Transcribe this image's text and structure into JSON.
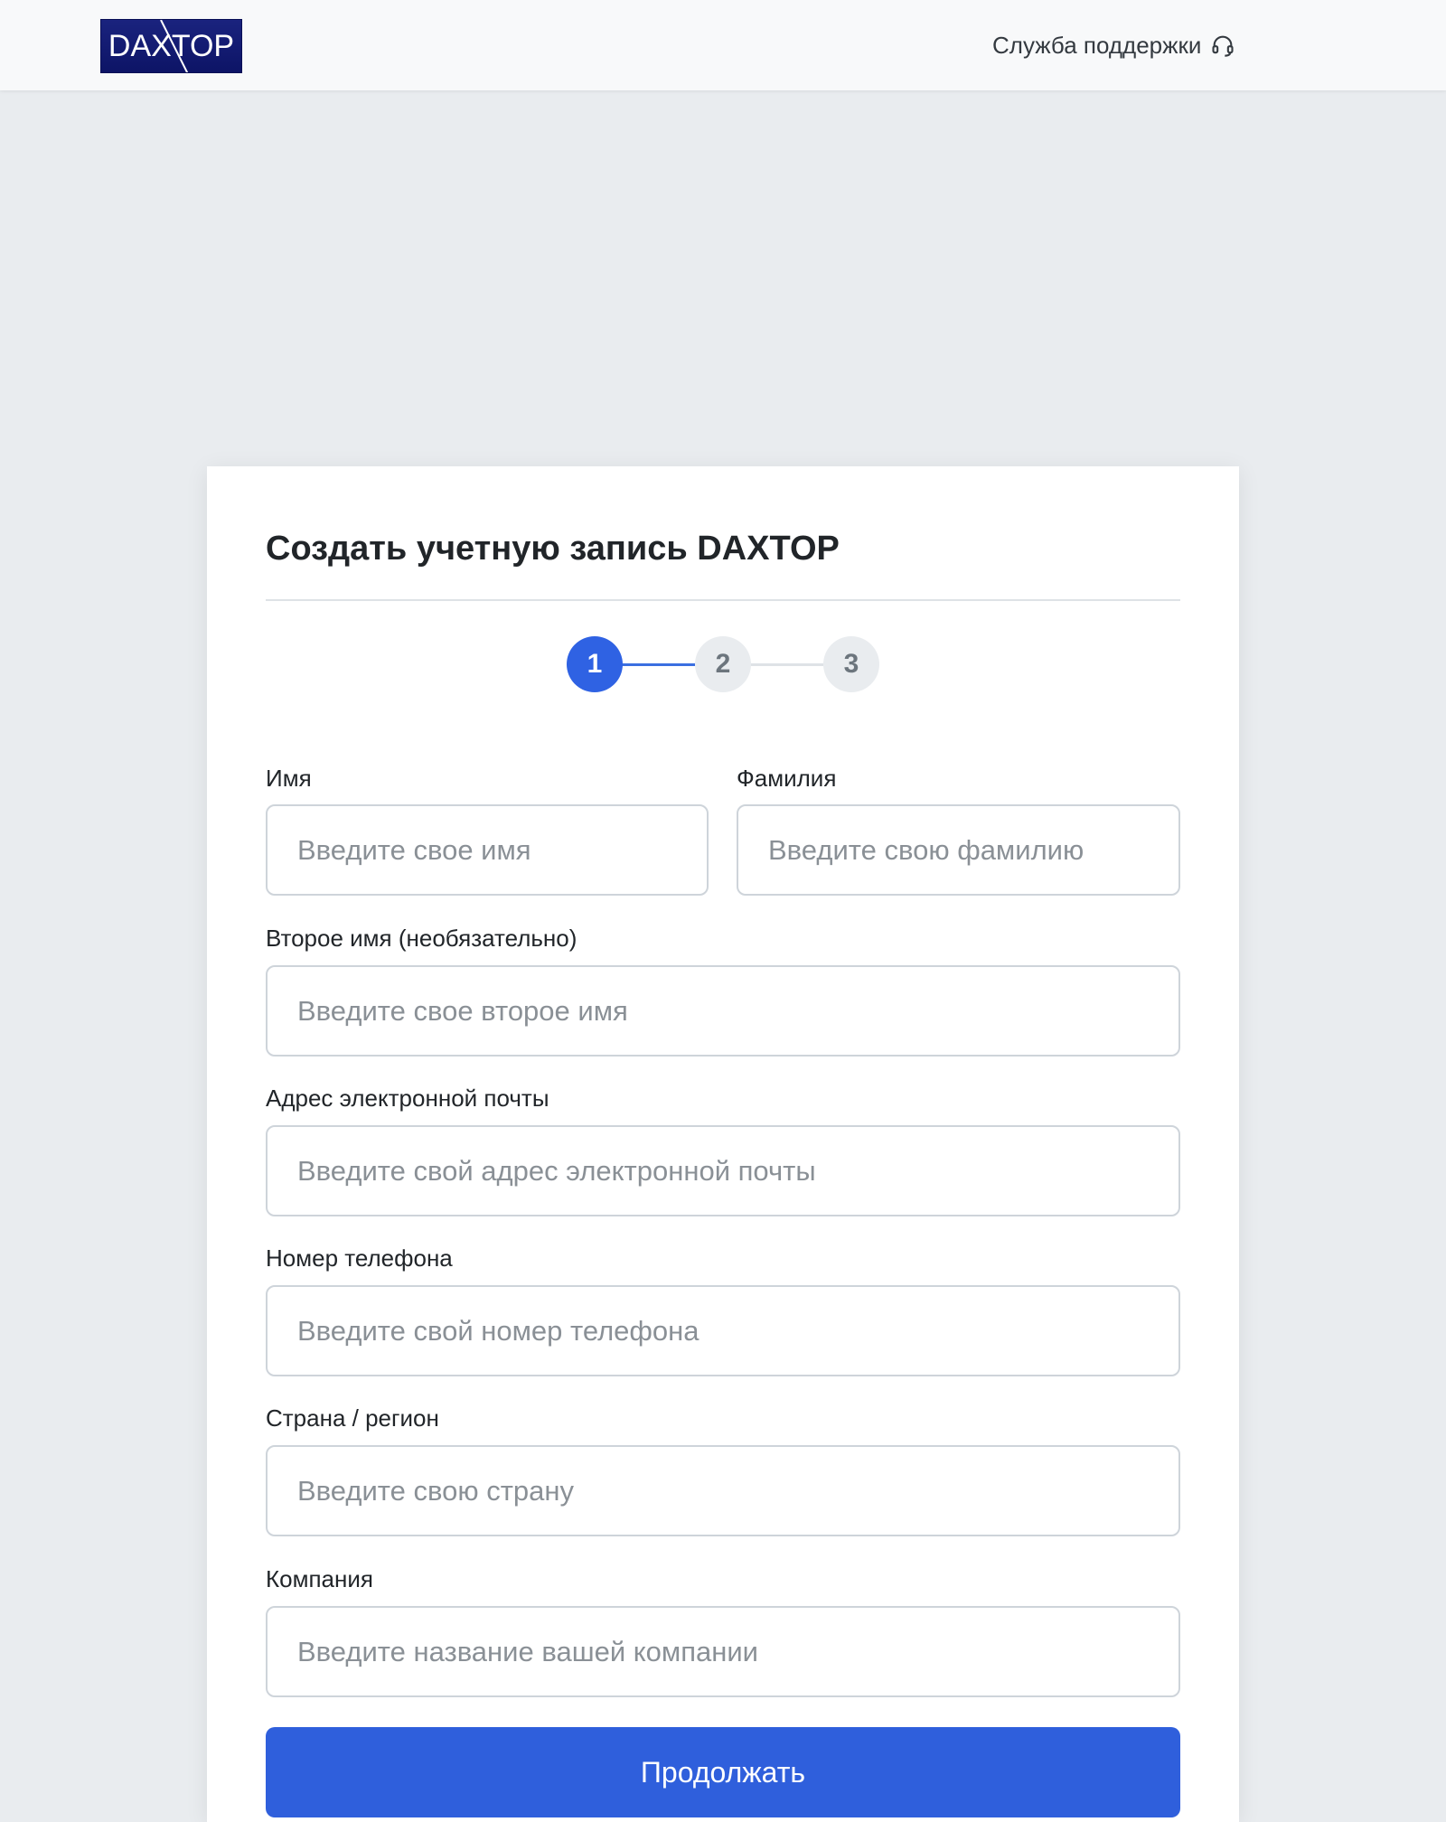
{
  "header": {
    "logo_text": "DAXTOP",
    "support_label": "Служба поддержки",
    "support_icon": "headset-icon"
  },
  "form": {
    "title": "Создать учетную запись DAXTOP",
    "steps": [
      "1",
      "2",
      "3"
    ],
    "current_step": 1,
    "first_name": {
      "label": "Имя",
      "placeholder": "Введите свое имя"
    },
    "last_name": {
      "label": "Фамилия",
      "placeholder": "Введите свою фамилию"
    },
    "middle_name": {
      "label": "Второе имя (необязательно)",
      "placeholder": "Введите свое второе имя"
    },
    "email": {
      "label": "Адрес электронной почты",
      "placeholder": "Введите свой адрес электронной почты"
    },
    "phone": {
      "label": "Номер телефона",
      "placeholder": "Введите свой номер телефона"
    },
    "country": {
      "label": "Страна / регион",
      "placeholder": "Введите свою страну"
    },
    "company": {
      "label": "Компания",
      "placeholder": "Введите название вашей компании"
    },
    "submit_label": "Продолжать"
  },
  "colors": {
    "primary": "#2f5fdc",
    "step_active": "#2f62e3",
    "step_inactive": "#e9ecef",
    "logo_bg": "#1a237e"
  }
}
